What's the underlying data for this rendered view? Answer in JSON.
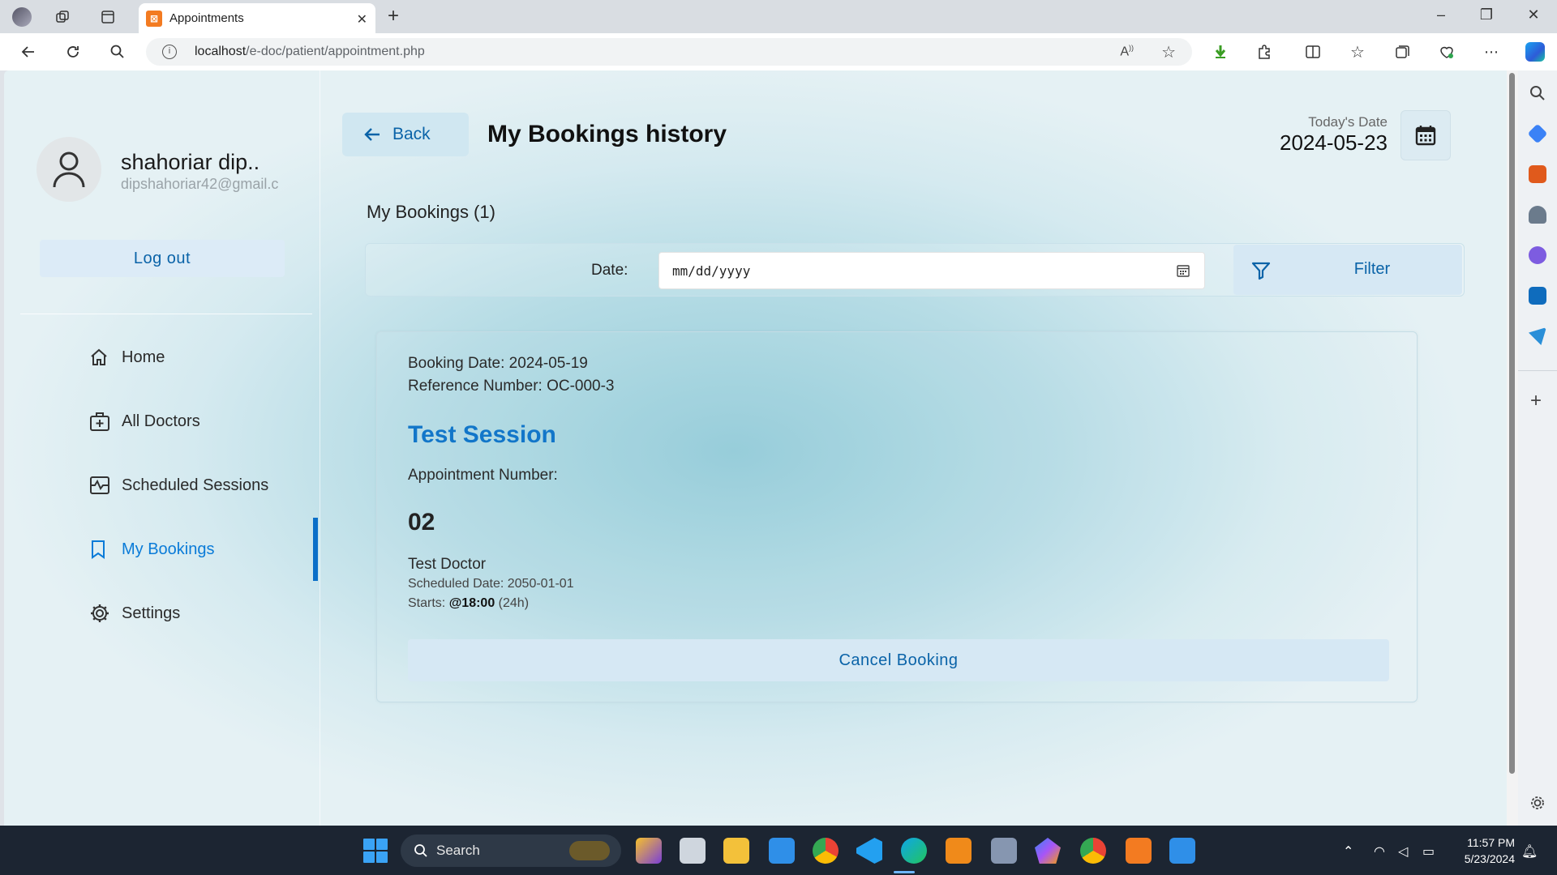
{
  "browser": {
    "tab_title": "Appointments",
    "url_host": "localhost",
    "url_path": "/e-doc/patient/appointment.php"
  },
  "sidebar": {
    "profile_name": "shahoriar dip..",
    "profile_email": "dipshahoriar42@gmail.c",
    "logout_label": "Log out",
    "items": [
      {
        "label": "Home",
        "icon": "home-icon"
      },
      {
        "label": "All Doctors",
        "icon": "doctor-case-icon"
      },
      {
        "label": "Scheduled Sessions",
        "icon": "schedule-icon"
      },
      {
        "label": "My Bookings",
        "icon": "bookmark-icon",
        "active": true
      },
      {
        "label": "Settings",
        "icon": "gear-icon"
      }
    ]
  },
  "header": {
    "back_label": "Back",
    "title": "My Bookings history",
    "today_label": "Today's Date",
    "today_value": "2024-05-23"
  },
  "main": {
    "bookings_heading": "My Bookings (1)",
    "date_label": "Date:",
    "date_placeholder": "mm/dd/yyyy",
    "filter_label": "Filter"
  },
  "booking": {
    "booking_date": "Booking Date: 2024-05-19",
    "reference": "Reference Number: OC-000-3",
    "session_title": "Test Session",
    "appointment_label": "Appointment Number:",
    "appointment_number": "02",
    "doctor": "Test Doctor",
    "scheduled_date": "Scheduled Date: 2050-01-01",
    "starts_prefix": "Starts: ",
    "starts_time": "@18:00",
    "starts_suffix": " (24h)",
    "cancel_label": "Cancel Booking"
  },
  "taskbar": {
    "search_label": "Search",
    "time": "11:57 PM",
    "date": "5/23/2024"
  },
  "colors": {
    "accent": "#0a63a8",
    "session_title": "#1276c9",
    "active_bar": "#0a6fc8"
  }
}
